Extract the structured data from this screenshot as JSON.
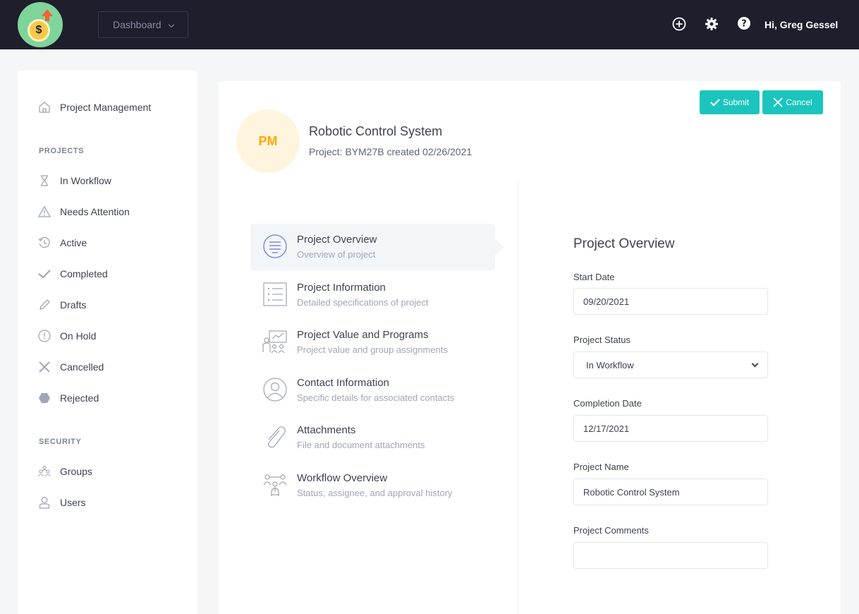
{
  "header": {
    "dashboard_label": "Dashboard",
    "greeting_prefix": "Hi,",
    "user_name": "Greg Gessel",
    "logo_symbol": "$"
  },
  "sidebar": {
    "top_item": {
      "label": "Project Management",
      "icon": "home-icon"
    },
    "projects_section": "PROJECTS",
    "projects": [
      {
        "label": "In Workflow",
        "icon": "hourglass-icon"
      },
      {
        "label": "Needs Attention",
        "icon": "warning-icon"
      },
      {
        "label": "Active",
        "icon": "history-icon"
      },
      {
        "label": "Completed",
        "icon": "check-icon"
      },
      {
        "label": "Drafts",
        "icon": "pencil-icon"
      },
      {
        "label": "On Hold",
        "icon": "exclamation-circle-icon"
      },
      {
        "label": "Cancelled",
        "icon": "x-icon"
      },
      {
        "label": "Rejected",
        "icon": "hexagon-icon"
      }
    ],
    "security_section": "SECURITY",
    "security": [
      {
        "label": "Groups",
        "icon": "group-icon"
      },
      {
        "label": "Users",
        "icon": "user-icon"
      }
    ]
  },
  "actions": {
    "submit_label": "Submit",
    "cancel_label": "Cancel"
  },
  "project": {
    "initials": "PM",
    "title": "Robotic Control System",
    "subtitle": "Project: BYM27B created 02/26/2021"
  },
  "steps": [
    {
      "title": "Project Overview",
      "desc": "Overview of project",
      "icon": "list-circle-icon",
      "active": true
    },
    {
      "title": "Project Information",
      "desc": "Detailed specifications of project",
      "icon": "checklist-icon",
      "active": false
    },
    {
      "title": "Project Value and Programs",
      "desc": "Project value and group assignments",
      "icon": "presentation-icon",
      "active": false
    },
    {
      "title": "Contact Information",
      "desc": "Specific details for associated contacts",
      "icon": "contact-icon",
      "active": false
    },
    {
      "title": "Attachments",
      "desc": "File and document attachments",
      "icon": "paperclip-icon",
      "active": false
    },
    {
      "title": "Workflow Overview",
      "desc": "Status, assignee, and approval history",
      "icon": "workflow-icon",
      "active": false
    }
  ],
  "form": {
    "title": "Project Overview",
    "start_date_label": "Start Date",
    "start_date": "09/20/2021",
    "status_label": "Project Status",
    "status": "In Workflow",
    "completion_date_label": "Completion Date",
    "completion_date": "12/17/2021",
    "name_label": "Project Name",
    "name": "Robotic Control System",
    "comments_label": "Project Comments",
    "comments": ""
  },
  "colors": {
    "topbar": "#1e1e2d",
    "accent": "#1bc5bd",
    "avatar_bg": "#fff4de",
    "avatar_text": "#ffa800"
  }
}
